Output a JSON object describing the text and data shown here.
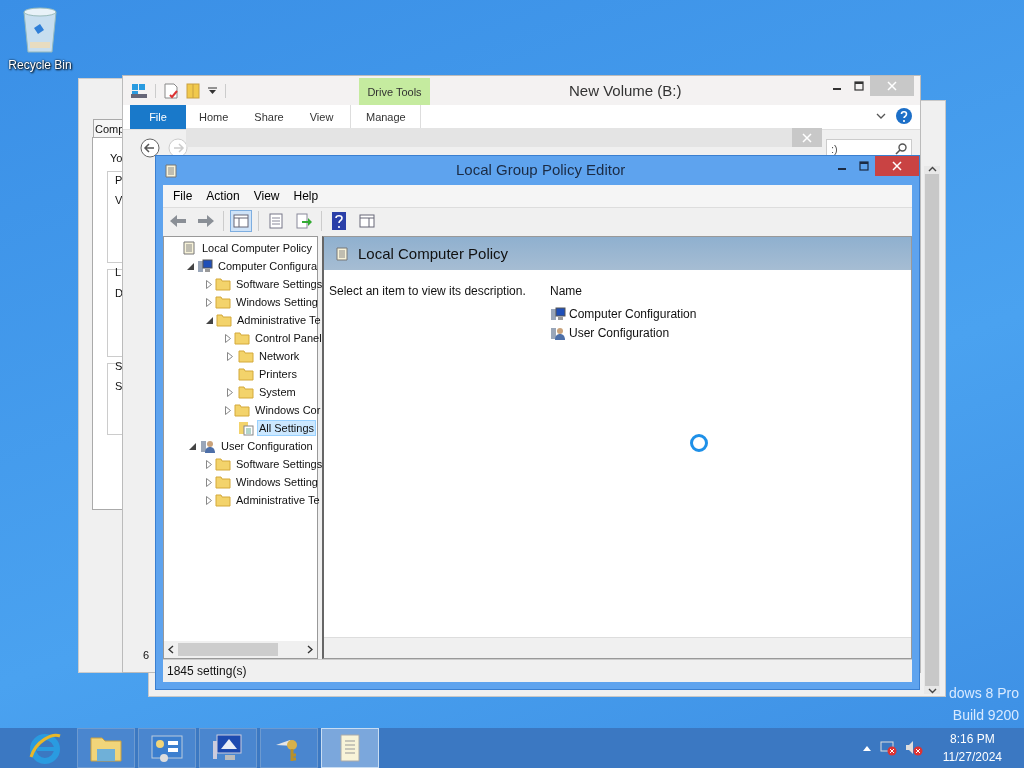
{
  "desktop": {
    "icons": [
      {
        "label": "Recycle Bin"
      }
    ],
    "watermark": [
      "dows 8 Pro",
      "Build 9200"
    ]
  },
  "background_window": {
    "tab": "Comp",
    "fragments": [
      "Yo",
      "P",
      "V",
      "L",
      "D",
      "S",
      "S"
    ]
  },
  "explorer": {
    "title": "New Volume (B:)",
    "contextual_group": "Drive Tools",
    "ribbon_tabs": [
      {
        "label": "File",
        "kind": "file"
      },
      {
        "label": "Home",
        "kind": "tab"
      },
      {
        "label": "Share",
        "kind": "tab"
      },
      {
        "label": "View",
        "kind": "tab"
      },
      {
        "label": "Manage",
        "kind": "contextual"
      }
    ],
    "search": {
      "placeholder": ":)"
    },
    "status": "6"
  },
  "gpe": {
    "title": "Local Group Policy Editor",
    "menu": [
      "File",
      "Action",
      "View",
      "Help"
    ],
    "toolbar": [
      {
        "kind": "back",
        "selected": false
      },
      {
        "kind": "forward",
        "selected": false
      },
      {
        "kind": "tree",
        "selected": true
      },
      {
        "kind": "list",
        "selected": false
      },
      {
        "kind": "export",
        "selected": false
      },
      {
        "kind": "help",
        "selected": false
      },
      {
        "kind": "properties",
        "selected": false
      }
    ],
    "tree": [
      {
        "label": "Local Computer Policy",
        "kind": "policy",
        "selected": false,
        "children": [
          {
            "label": "Computer Configura",
            "kind": "computer",
            "expanded": true,
            "selected": false,
            "children": [
              {
                "label": "Software Settings",
                "kind": "folder",
                "expanded": false,
                "selected": false
              },
              {
                "label": "Windows Setting",
                "kind": "folder",
                "expanded": false,
                "selected": false
              },
              {
                "label": "Administrative Te",
                "kind": "folder",
                "expanded": true,
                "selected": false,
                "children": [
                  {
                    "label": "Control Panel",
                    "kind": "folder",
                    "expanded": false,
                    "selected": false
                  },
                  {
                    "label": "Network",
                    "kind": "folder",
                    "expanded": false,
                    "selected": false
                  },
                  {
                    "label": "Printers",
                    "kind": "folder",
                    "selected": false
                  },
                  {
                    "label": "System",
                    "kind": "folder",
                    "expanded": false,
                    "selected": false
                  },
                  {
                    "label": "Windows Cor",
                    "kind": "folder",
                    "expanded": false,
                    "selected": false
                  },
                  {
                    "label": "All Settings",
                    "kind": "settings",
                    "selected": true
                  }
                ]
              }
            ]
          },
          {
            "label": "User Configuration",
            "kind": "user",
            "expanded": true,
            "selected": false,
            "children": [
              {
                "label": "Software Settings",
                "kind": "folder",
                "expanded": false,
                "selected": false
              },
              {
                "label": "Windows Setting",
                "kind": "folder",
                "expanded": false,
                "selected": false
              },
              {
                "label": "Administrative Te",
                "kind": "folder",
                "expanded": false,
                "selected": false
              }
            ]
          }
        ]
      }
    ],
    "details": {
      "heading": "Local Computer Policy",
      "description": "Select an item to view its description.",
      "columns": [
        "Name"
      ],
      "items": [
        {
          "label": "Computer Configuration",
          "kind": "computer"
        },
        {
          "label": "User Configuration",
          "kind": "user"
        }
      ]
    },
    "status": "1845 setting(s)"
  },
  "taskbar": {
    "apps": [
      {
        "kind": "browser",
        "selected": false
      },
      {
        "kind": "files",
        "selected": false
      },
      {
        "kind": "control",
        "selected": false
      },
      {
        "kind": "computer",
        "selected": false
      },
      {
        "kind": "keys",
        "selected": false
      },
      {
        "kind": "scroll",
        "selected": true
      }
    ],
    "clock": {
      "time": "8:16 PM",
      "date": "11/27/2024"
    }
  }
}
